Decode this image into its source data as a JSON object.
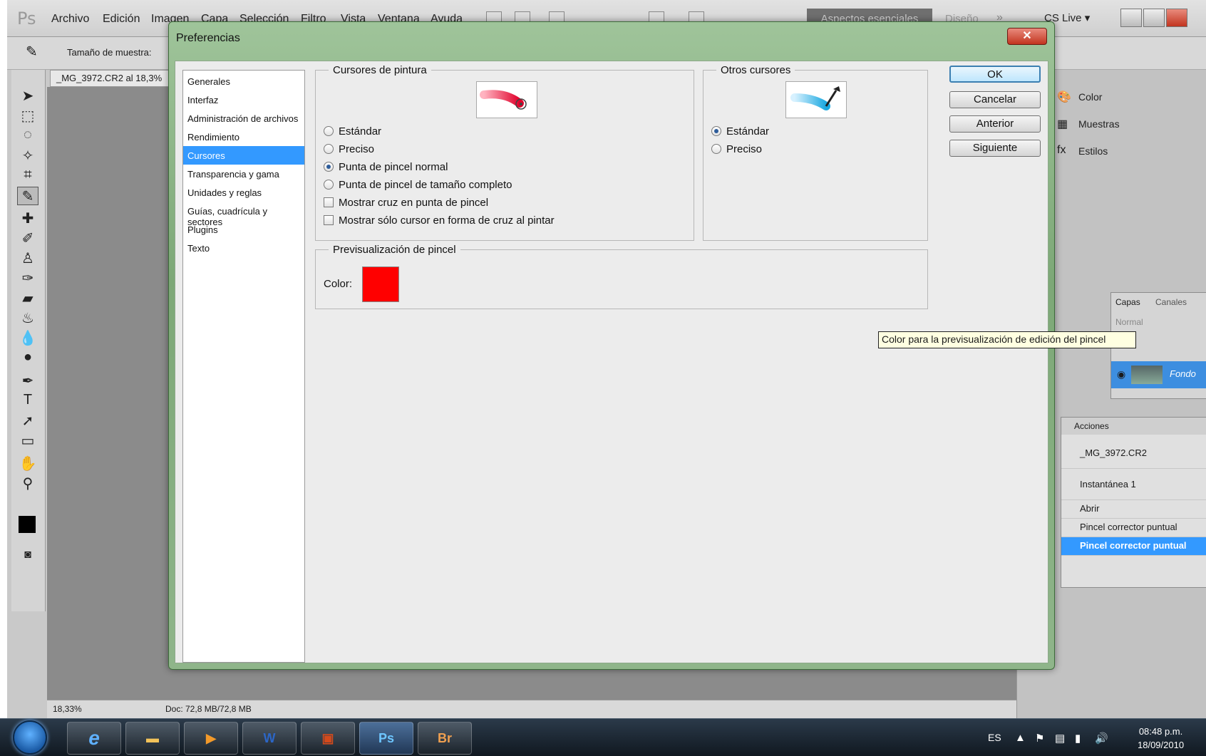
{
  "app": {
    "logo": "Ps",
    "menu": [
      "Archivo",
      "Edición",
      "Imagen",
      "Capa",
      "Selección",
      "Filtro",
      "Vista",
      "Ventana",
      "Ayuda"
    ],
    "workspace_active": "Aspectos esenciales",
    "workspace_next": "Diseño",
    "workspace_more": "»",
    "cslive": "CS Live ▾",
    "options_label": "Tamaño de muestra:",
    "document_tab": "_MG_3972.CR2 al 18,3%",
    "status_zoom": "18,33%",
    "status_doc": "Doc: 72,8 MB/72,8 MB"
  },
  "panels": {
    "color": "Color",
    "swatches": "Muestras",
    "styles": "Estilos",
    "layers_tab": "Capas",
    "channels_tab": "Canales",
    "blend_mode": "Normal",
    "layer_name": "Fondo",
    "actions_tab": "Acciones",
    "history": [
      {
        "label": "_MG_3972.CR2"
      },
      {
        "label": "Instantánea 1"
      },
      {
        "label": "Abrir"
      },
      {
        "label": "Pincel corrector puntual"
      },
      {
        "label": "Pincel corrector puntual"
      }
    ]
  },
  "dialog": {
    "title": "Preferencias",
    "close": "✕",
    "categories": [
      {
        "label": "Generales"
      },
      {
        "label": "Interfaz"
      },
      {
        "label": "Administración de archivos"
      },
      {
        "label": "Rendimiento"
      },
      {
        "label": "Cursores"
      },
      {
        "label": "Transparencia y gama"
      },
      {
        "label": "Unidades y reglas"
      },
      {
        "label": "Guías, cuadrícula y sectores"
      },
      {
        "label": "Plugins"
      },
      {
        "label": "Texto"
      }
    ],
    "selected_category": "Cursores",
    "painting": {
      "legend": "Cursores de pintura",
      "options": [
        {
          "label": "Estándar",
          "checked": false
        },
        {
          "label": "Preciso",
          "checked": false
        },
        {
          "label": "Punta de pincel normal",
          "checked": true
        },
        {
          "label": "Punta de pincel de tamaño completo",
          "checked": false
        }
      ],
      "checkboxes": [
        {
          "label": "Mostrar cruz en punta de pincel",
          "checked": false
        },
        {
          "label": "Mostrar sólo cursor en forma de cruz al pintar",
          "checked": false
        }
      ]
    },
    "other": {
      "legend": "Otros cursores",
      "options": [
        {
          "label": "Estándar",
          "checked": true
        },
        {
          "label": "Preciso",
          "checked": false
        }
      ]
    },
    "preview": {
      "legend": "Previsualización de pincel",
      "color_label": "Color:",
      "color": "#ff0000"
    },
    "buttons": {
      "ok": "OK",
      "cancel": "Cancelar",
      "previous": "Anterior",
      "next": "Siguiente"
    },
    "tooltip": "Color para la previsualización de edición del pincel"
  },
  "taskbar": {
    "apps": [
      "Ps",
      "Br"
    ],
    "language": "ES",
    "time": "08:48 p.m.",
    "date": "18/09/2010"
  }
}
